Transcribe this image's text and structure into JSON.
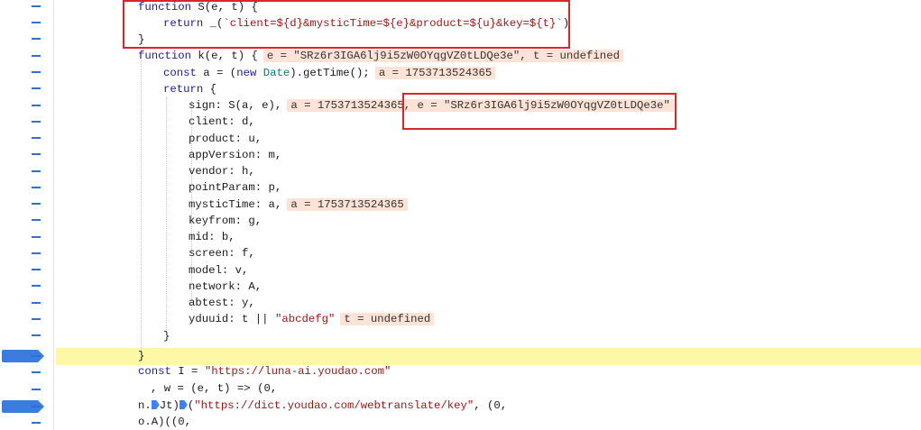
{
  "gutter": {
    "marker": "-"
  },
  "code": {
    "lines": [
      {
        "parts": [
          [
            "kw",
            "function"
          ],
          [
            "fn",
            " S(e, t) {"
          ]
        ]
      },
      {
        "parts": [
          [
            "kw",
            "return"
          ],
          [
            "fn",
            " _("
          ],
          [
            "tpl",
            "`client=${d}&mysticTime=${e}&product=${u}&key=${t}`"
          ],
          [
            "fn",
            ")"
          ]
        ]
      },
      {
        "parts": [
          [
            "fn",
            "}"
          ]
        ]
      },
      {
        "parts": [
          [
            "kw",
            "function"
          ],
          [
            "fn",
            " k(e, t) {"
          ]
        ],
        "hint": "e = \"SRz6r3IGA6lj9i5zW0OYqgVZ0tLDQe3e\", t = undefined"
      },
      {
        "parts": [
          [
            "kw",
            "const"
          ],
          [
            "fn",
            " a = ("
          ],
          [
            "kw",
            "new"
          ],
          [
            "fn",
            " "
          ],
          [
            "cls",
            "Date"
          ],
          [
            "fn",
            ").getTime();"
          ]
        ],
        "hint": "a = 1753713524365"
      },
      {
        "parts": [
          [
            "kw",
            "return"
          ],
          [
            "fn",
            " {"
          ]
        ]
      },
      {
        "parts": [
          [
            "fn",
            "sign: S(a, e),"
          ]
        ],
        "hint": "a = 1753713524365, e = \"SRz6r3IGA6lj9i5zW0OYqgVZ0tLDQe3e\""
      },
      {
        "parts": [
          [
            "fn",
            "client: d,"
          ]
        ]
      },
      {
        "parts": [
          [
            "fn",
            "product: u,"
          ]
        ]
      },
      {
        "parts": [
          [
            "fn",
            "appVersion: m,"
          ]
        ]
      },
      {
        "parts": [
          [
            "fn",
            "vendor: h,"
          ]
        ]
      },
      {
        "parts": [
          [
            "fn",
            "pointParam: p,"
          ]
        ]
      },
      {
        "parts": [
          [
            "fn",
            "mysticTime: a,"
          ]
        ],
        "hint": "a = 1753713524365"
      },
      {
        "parts": [
          [
            "fn",
            "keyfrom: g,"
          ]
        ]
      },
      {
        "parts": [
          [
            "fn",
            "mid: b,"
          ]
        ]
      },
      {
        "parts": [
          [
            "fn",
            "screen: f,"
          ]
        ]
      },
      {
        "parts": [
          [
            "fn",
            "model: v,"
          ]
        ]
      },
      {
        "parts": [
          [
            "fn",
            "network: A,"
          ]
        ]
      },
      {
        "parts": [
          [
            "fn",
            "abtest: y,"
          ]
        ]
      },
      {
        "parts": [
          [
            "fn",
            "yduuid: t || "
          ],
          [
            "str",
            "\"abcdefg\""
          ]
        ],
        "hint": "t = undefined"
      },
      {
        "parts": [
          [
            "fn",
            "}"
          ]
        ]
      },
      {
        "parts": [
          [
            "fn",
            "}"
          ]
        ]
      },
      {
        "parts": [
          [
            "kw",
            "const"
          ],
          [
            "fn",
            " I = "
          ],
          [
            "str",
            "\"https://luna-ai.youdao.com\""
          ]
        ]
      },
      {
        "parts": [
          [
            "fn",
            ", w = (e, t) => (0,"
          ]
        ]
      },
      {
        "parts": [
          [
            "fn",
            "n."
          ],
          [
            "mark",
            ""
          ],
          [
            "fn",
            "Jt)"
          ],
          [
            "mark",
            ""
          ],
          [
            "fn",
            "("
          ],
          [
            "str",
            "\"https://dict.youdao.com/webtranslate/key\""
          ],
          [
            "fn",
            ", (0,"
          ]
        ]
      },
      {
        "parts": [
          [
            "fn",
            "o.A)((0,"
          ]
        ]
      }
    ]
  }
}
